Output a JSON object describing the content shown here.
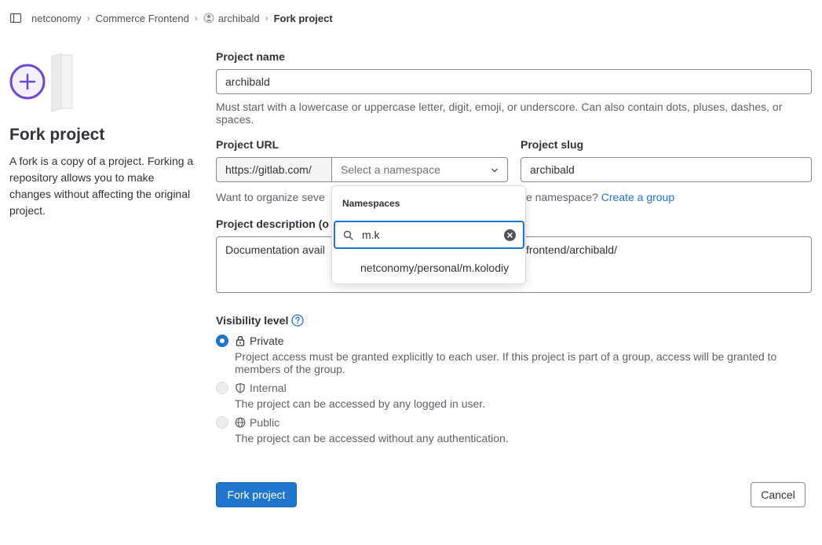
{
  "breadcrumb": {
    "items": [
      "netconomy",
      "Commerce Frontend",
      "archibald",
      "Fork project"
    ]
  },
  "left": {
    "title": "Fork project",
    "description": "A fork is a copy of a project. Forking a repository allows you to make changes without affecting the original project."
  },
  "form": {
    "project_name_label": "Project name",
    "project_name_value": "archibald",
    "project_name_help": "Must start with a lowercase or uppercase letter, digit, emoji, or underscore. Can also contain dots, pluses, dashes, or spaces.",
    "project_url_label": "Project URL",
    "project_url_prefix": "https://gitlab.com/",
    "namespace_placeholder": "Select a namespace",
    "project_slug_label": "Project slug",
    "project_slug_value": "archibald",
    "organize_help_prefix": "Want to organize seve",
    "organize_help_suffix": "e namespace?",
    "create_group_link": "Create a group",
    "description_label": "Project description (o",
    "description_value_left": "Documentation avail",
    "description_value_right": "frontend/archibald/"
  },
  "dropdown": {
    "header": "Namespaces",
    "search_value": "m.k",
    "items": [
      "netconomy/personal/m.kolodiy"
    ]
  },
  "visibility": {
    "label": "Visibility level",
    "options": [
      {
        "label": "Private",
        "help": "Project access must be granted explicitly to each user. If this project is part of a group, access will be granted to members of the group."
      },
      {
        "label": "Internal",
        "help": "The project can be accessed by any logged in user."
      },
      {
        "label": "Public",
        "help": "The project can be accessed without any authentication."
      }
    ]
  },
  "actions": {
    "fork_label": "Fork project",
    "cancel_label": "Cancel"
  },
  "colors": {
    "primary": "#1f75cb",
    "illustration": "#6e49cb"
  }
}
